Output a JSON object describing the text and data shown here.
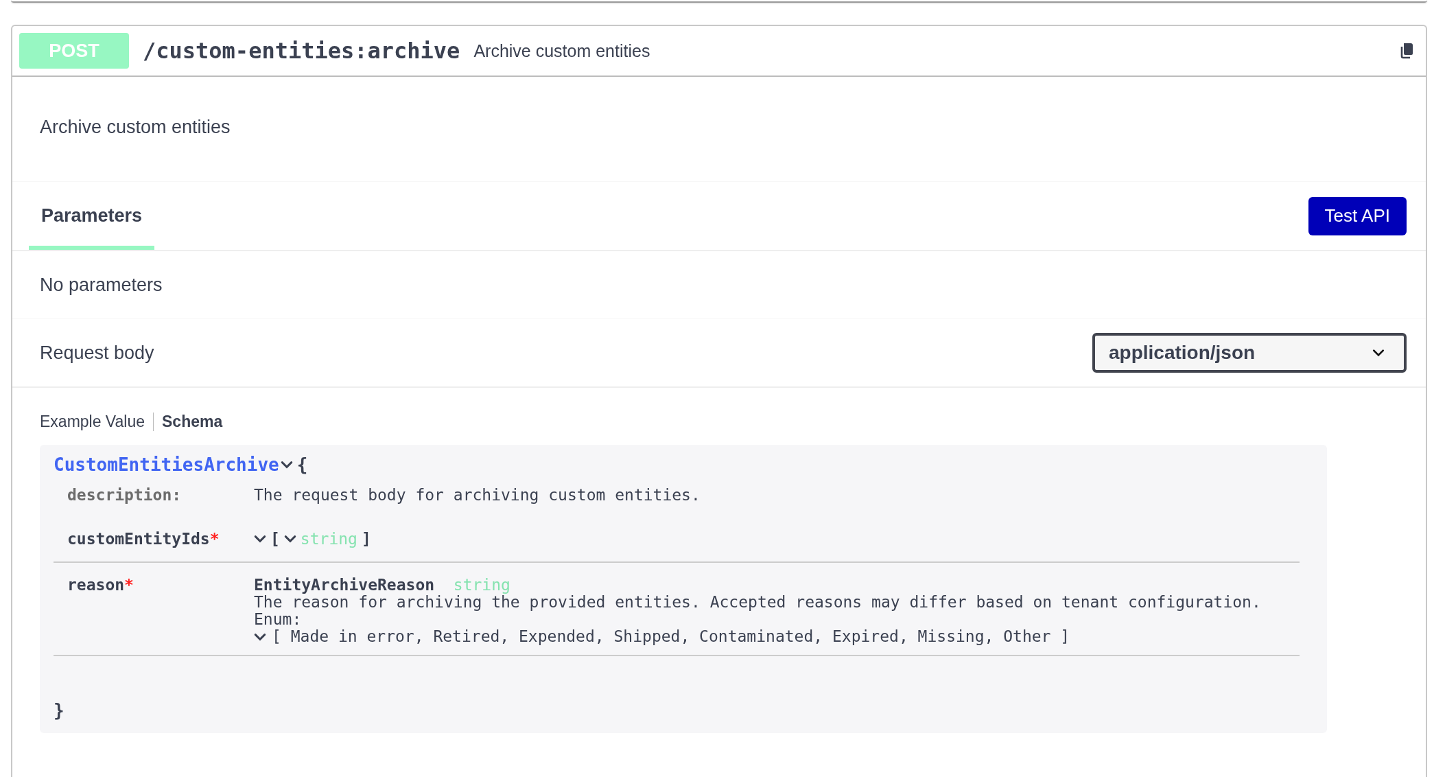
{
  "operation": {
    "method": "POST",
    "path": "/custom-entities:archive",
    "summary": "Archive custom entities"
  },
  "description": "Archive custom entities",
  "tabs": [
    {
      "label": "Parameters",
      "selected": true
    }
  ],
  "test_button": "Test API",
  "parameters_message": "No parameters",
  "request_body": {
    "label": "Request body",
    "content_type": "application/json"
  },
  "example_tabs": [
    {
      "label": "Example Value",
      "selected": false
    },
    {
      "label": "Schema",
      "selected": true
    }
  ],
  "schema": {
    "name": "CustomEntitiesArchive",
    "open_brace": "{",
    "close_brace": "}",
    "required_mark": "*",
    "properties": [
      {
        "kind": "description",
        "name": "description:",
        "value": "The request body for archiving custom entities."
      },
      {
        "kind": "array",
        "name": "customEntityIds",
        "required": true,
        "open": "[",
        "item_type": "string",
        "close": "]"
      },
      {
        "kind": "enum",
        "name": "reason",
        "required": true,
        "ref": "EntityArchiveReason",
        "type": "string",
        "description": "The reason for archiving the provided entities. Accepted reasons may differ based on tenant configuration.",
        "enum_label": "Enum:",
        "enum_values": "[ Made in error, Retired, Expended, Shipped, Contaminated, Expired, Missing, Other ]"
      }
    ]
  }
}
